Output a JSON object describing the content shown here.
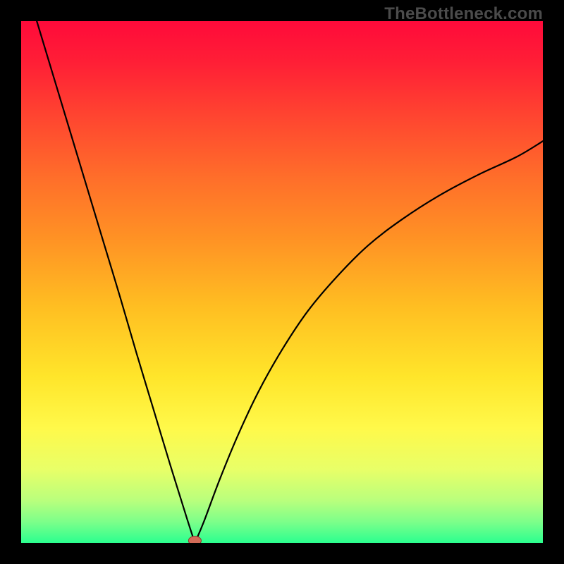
{
  "watermark": "TheBottleneck.com",
  "colors": {
    "frame": "#000000",
    "curve": "#000000",
    "marker_fill": "#d26b58",
    "marker_stroke": "#88382a",
    "gradient_stops": [
      {
        "offset": 0.0,
        "color": "#ff0a3a"
      },
      {
        "offset": 0.08,
        "color": "#ff1f36"
      },
      {
        "offset": 0.18,
        "color": "#ff4430"
      },
      {
        "offset": 0.3,
        "color": "#ff6e2a"
      },
      {
        "offset": 0.42,
        "color": "#ff9324"
      },
      {
        "offset": 0.55,
        "color": "#ffbf22"
      },
      {
        "offset": 0.68,
        "color": "#ffe52a"
      },
      {
        "offset": 0.78,
        "color": "#fff94a"
      },
      {
        "offset": 0.86,
        "color": "#e8ff68"
      },
      {
        "offset": 0.92,
        "color": "#b8ff7d"
      },
      {
        "offset": 0.96,
        "color": "#7cff8a"
      },
      {
        "offset": 1.0,
        "color": "#2bff8f"
      }
    ]
  },
  "chart_data": {
    "type": "line",
    "title": "",
    "xlabel": "",
    "ylabel": "",
    "xlim": [
      0,
      100
    ],
    "ylim": [
      0,
      100
    ],
    "note": "A single V-shaped curve with minimum (≈0) near x≈33; left branch rises steeply past y=100 near x≈3; right branch rises with decreasing slope toward y≈77 at x=100. A small marker sits at the minimum.",
    "series": [
      {
        "name": "bottleneck-curve",
        "x": [
          3.0,
          6.2,
          9.4,
          12.6,
          15.8,
          19.0,
          22.1,
          25.3,
          28.5,
          31.8,
          33.3,
          35.0,
          38.0,
          41.5,
          45.5,
          50.0,
          55.0,
          60.5,
          66.5,
          73.0,
          80.0,
          87.5,
          95.0,
          100.0
        ],
        "y": [
          100.0,
          89.4,
          78.8,
          68.2,
          57.6,
          47.0,
          36.4,
          25.8,
          15.2,
          4.6,
          0.0,
          4.0,
          12.0,
          20.5,
          29.0,
          37.0,
          44.5,
          51.0,
          57.0,
          62.0,
          66.5,
          70.5,
          74.0,
          77.0
        ]
      }
    ],
    "marker": {
      "x": 33.3,
      "y": 0.0
    }
  }
}
